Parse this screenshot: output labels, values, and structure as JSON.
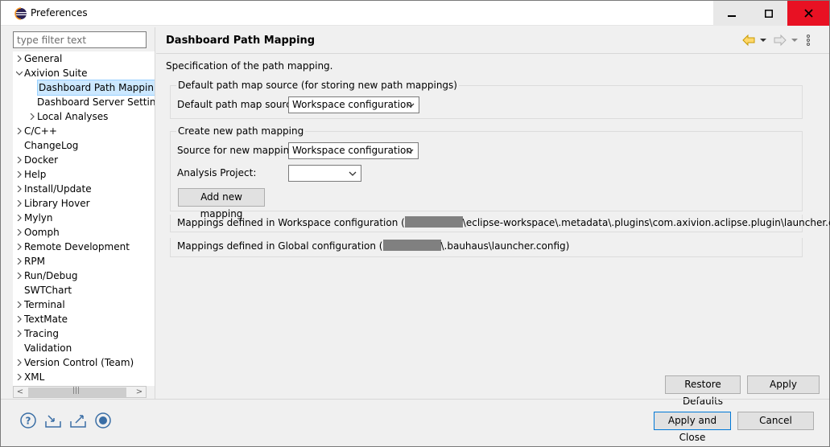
{
  "window": {
    "title": "Preferences",
    "buttons": {
      "minimize": "minimize",
      "maximize": "maximize",
      "close": "close"
    }
  },
  "filter": {
    "placeholder": "type filter text",
    "value": ""
  },
  "tree": {
    "items": [
      {
        "label": "General",
        "expander": "collapsed"
      },
      {
        "label": "Axivion Suite",
        "expander": "expanded"
      },
      {
        "label": "Dashboard Path Mappin",
        "expander": "none",
        "selected": true
      },
      {
        "label": "Dashboard Server Setting",
        "expander": "none"
      },
      {
        "label": "Local Analyses",
        "expander": "collapsed"
      },
      {
        "label": "C/C++",
        "expander": "collapsed"
      },
      {
        "label": "ChangeLog",
        "expander": "none"
      },
      {
        "label": "Docker",
        "expander": "collapsed"
      },
      {
        "label": "Help",
        "expander": "collapsed"
      },
      {
        "label": "Install/Update",
        "expander": "collapsed"
      },
      {
        "label": "Library Hover",
        "expander": "collapsed"
      },
      {
        "label": "Mylyn",
        "expander": "collapsed"
      },
      {
        "label": "Oomph",
        "expander": "collapsed"
      },
      {
        "label": "Remote Development",
        "expander": "collapsed"
      },
      {
        "label": "RPM",
        "expander": "collapsed"
      },
      {
        "label": "Run/Debug",
        "expander": "collapsed"
      },
      {
        "label": "SWTChart",
        "expander": "none"
      },
      {
        "label": "Terminal",
        "expander": "collapsed"
      },
      {
        "label": "TextMate",
        "expander": "collapsed"
      },
      {
        "label": "Tracing",
        "expander": "collapsed"
      },
      {
        "label": "Validation",
        "expander": "none"
      },
      {
        "label": "Version Control (Team)",
        "expander": "collapsed"
      },
      {
        "label": "XML",
        "expander": "collapsed"
      }
    ],
    "scroll_left": "<",
    "scroll_right": ">",
    "scroll_grip": "|||"
  },
  "page": {
    "title": "Dashboard Path Mapping",
    "description": "Specification of the path mapping.",
    "group_default": {
      "title": "Default path map source (for storing new path mappings)",
      "label": "Default path map source:",
      "value": "Workspace configuration"
    },
    "group_create": {
      "title": "Create new path mapping",
      "source_label": "Source for new mapping:",
      "source_value": "Workspace configuration",
      "project_label": "Analysis Project:",
      "project_value": "",
      "add_button": "Add new mapping"
    },
    "workspace_mappings": {
      "prefix": "Mappings defined in Workspace configuration (",
      "suffix": "\\eclipse-workspace\\.metadata\\.plugins\\com.axivion.aclipse.plugin\\launcher.config)"
    },
    "global_mappings": {
      "prefix": "Mappings defined in Global configuration (",
      "suffix": "\\.bauhaus\\launcher.config)"
    },
    "restore_defaults": "Restore Defaults",
    "apply": "Apply"
  },
  "footer": {
    "apply_and_close": "Apply and Close",
    "cancel": "Cancel",
    "icons": [
      "help-icon",
      "import-icon",
      "export-icon",
      "record-icon"
    ]
  },
  "colors": {
    "selection": "#cce8ff",
    "close_button": "#e81123",
    "accent": "#0078d7"
  }
}
